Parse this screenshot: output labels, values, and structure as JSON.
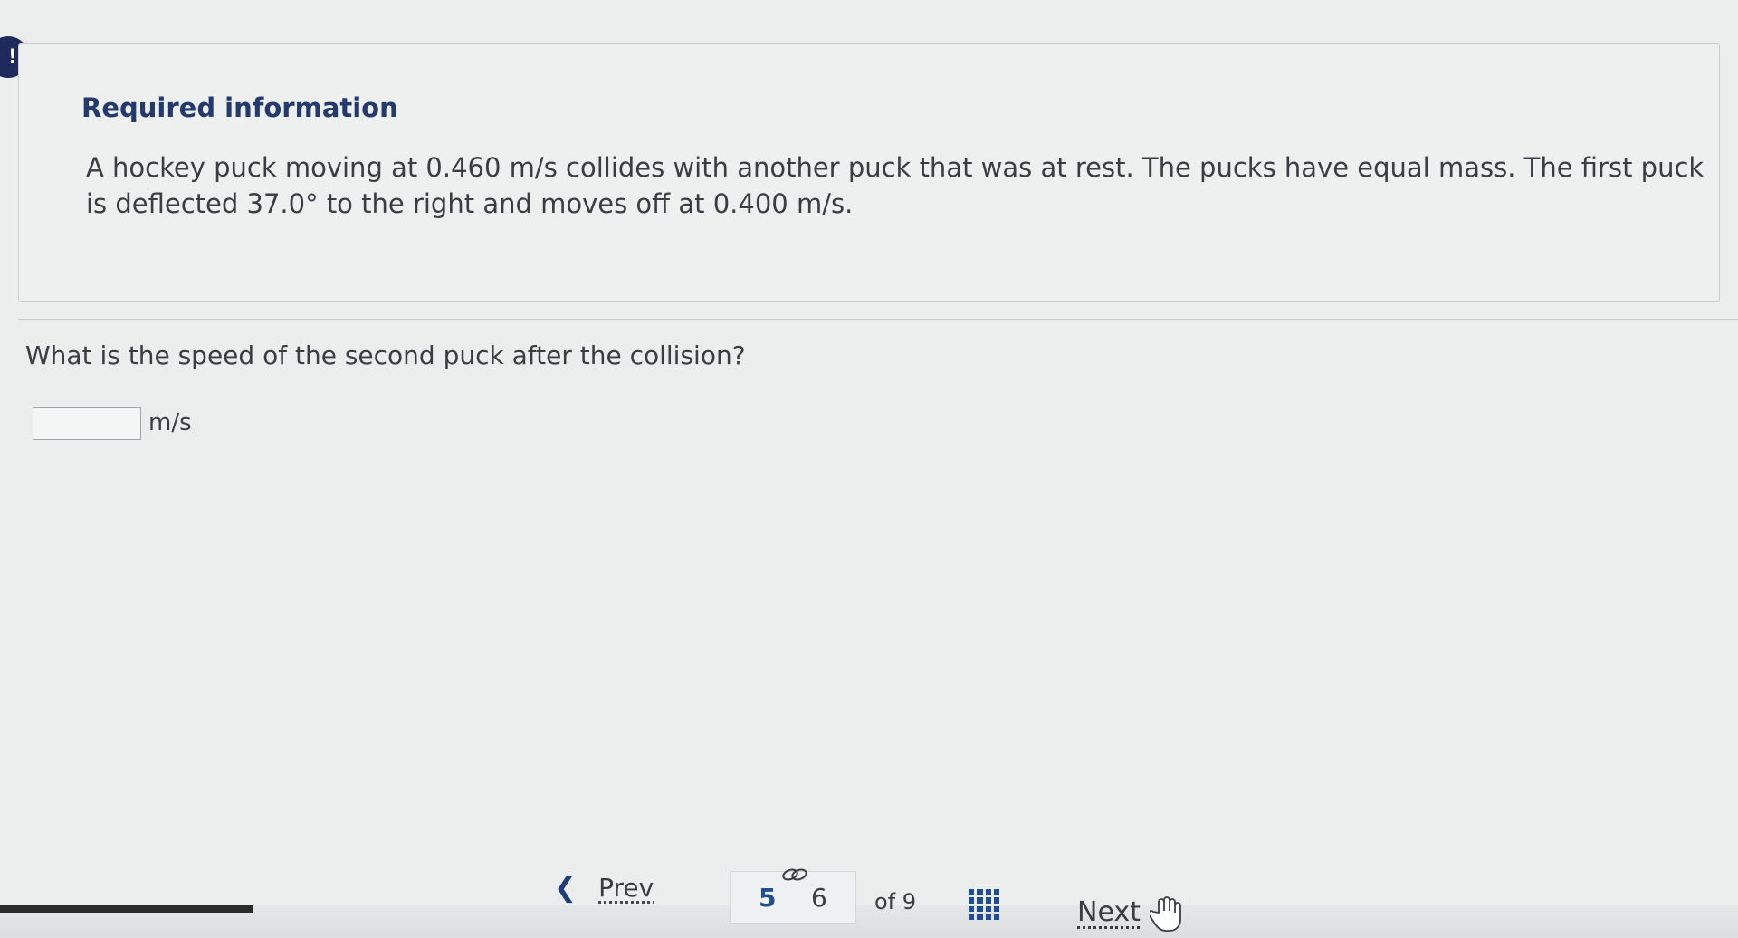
{
  "alert": {
    "symbol": "!"
  },
  "info": {
    "heading": "Required information",
    "text": "A hockey puck moving at 0.460 m/s collides with another puck that was at rest. The pucks have equal mass. The first puck is deflected 37.0° to the right and moves off at 0.400 m/s."
  },
  "question": {
    "text": "What is the speed of the second puck after the collision?",
    "answer_value": "",
    "unit": "m/s"
  },
  "navigation": {
    "prev_label": "Prev",
    "prev_icon": "chevron-left-icon",
    "pages": [
      "5",
      "6"
    ],
    "current_page": "5",
    "of_text": "of 9",
    "next_label": "Next",
    "grid_icon": "grid-icon",
    "link_icon": "link-icon",
    "cursor_icon": "hand-pointer-icon"
  },
  "colors": {
    "accent": "#1f4e96",
    "heading": "#223a6e",
    "badge": "#1f2a5c"
  }
}
